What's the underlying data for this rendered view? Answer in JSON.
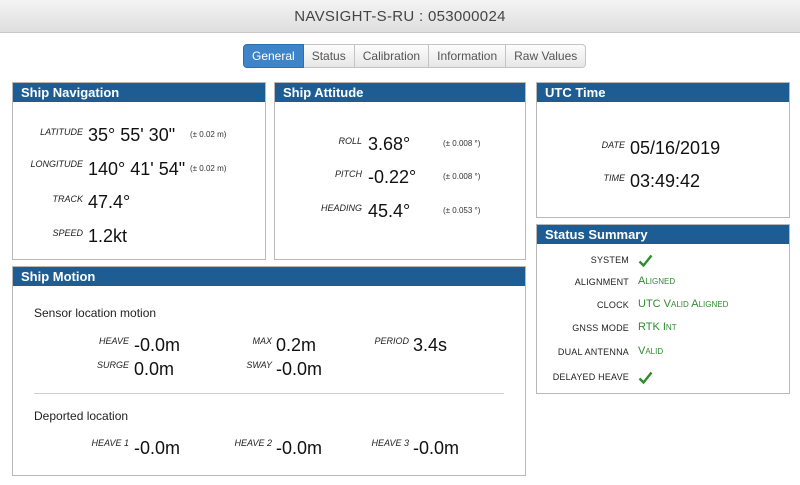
{
  "header": {
    "title": "NAVSIGHT-S-RU : 053000024"
  },
  "tabs": [
    {
      "label": "General",
      "active": true
    },
    {
      "label": "Status"
    },
    {
      "label": "Calibration"
    },
    {
      "label": "Information"
    },
    {
      "label": "Raw Values"
    }
  ],
  "ship_navigation": {
    "title": "Ship Navigation",
    "latitude": {
      "label": "LATITUDE",
      "value": "35° 55' 30\"",
      "accuracy": "(± 0.02 m)"
    },
    "longitude": {
      "label": "LONGITUDE",
      "value": "140° 41' 54\"",
      "accuracy": "(± 0.02 m)"
    },
    "track": {
      "label": "TRACK",
      "value": "47.4°"
    },
    "speed": {
      "label": "SPEED",
      "value": "1.2kt"
    }
  },
  "ship_attitude": {
    "title": "Ship Attitude",
    "roll": {
      "label": "ROLL",
      "value": "3.68°",
      "accuracy": "(± 0.008 °)"
    },
    "pitch": {
      "label": "PITCH",
      "value": "-0.22°",
      "accuracy": "(± 0.008 °)"
    },
    "heading": {
      "label": "HEADING",
      "value": "45.4°",
      "accuracy": "(± 0.053 °)"
    }
  },
  "utc_time": {
    "title": "UTC Time",
    "date": {
      "label": "DATE",
      "value": "05/16/2019"
    },
    "time": {
      "label": "TIME",
      "value": "03:49:42"
    }
  },
  "ship_motion": {
    "title": "Ship Motion",
    "sensor_title": "Sensor location motion",
    "heave": {
      "label": "HEAVE",
      "value": "-0.0m"
    },
    "max": {
      "label": "MAX",
      "value": "0.2m"
    },
    "period": {
      "label": "PERIOD",
      "value": "3.4s"
    },
    "surge": {
      "label": "SURGE",
      "value": "0.0m"
    },
    "sway": {
      "label": "SWAY",
      "value": "-0.0m"
    },
    "deported_title": "Deported location",
    "heave1": {
      "label": "HEAVE 1",
      "value": "-0.0m"
    },
    "heave2": {
      "label": "HEAVE 2",
      "value": "-0.0m"
    },
    "heave3": {
      "label": "HEAVE 3",
      "value": "-0.0m"
    }
  },
  "status_summary": {
    "title": "Status Summary",
    "system": {
      "label": "SYSTEM",
      "icon": "check-icon"
    },
    "alignment": {
      "label": "ALIGNMENT",
      "value": "Aligned"
    },
    "clock": {
      "label": "CLOCK",
      "value": "UTC Valid Aligned"
    },
    "gnss_mode": {
      "label": "GNSS MODE",
      "value": "RTK Int"
    },
    "dual_antenna": {
      "label": "DUAL ANTENNA",
      "value": "Valid"
    },
    "delayed_heave": {
      "label": "DELAYED HEAVE",
      "icon": "check-icon"
    }
  },
  "colors": {
    "header_blue": "#1d5d93",
    "tab_active": "#3e84c9",
    "status_green": "#2e8b2e"
  }
}
